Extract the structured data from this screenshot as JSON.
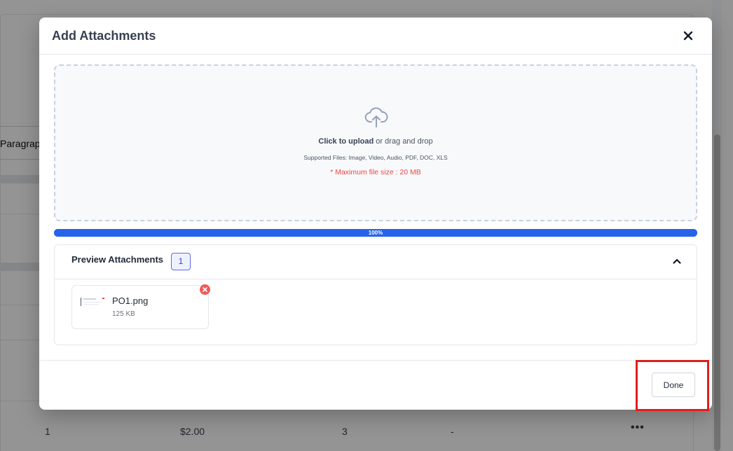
{
  "background": {
    "toolbar_fragment": "Paragraph",
    "row": {
      "col1": "1",
      "col2": "$2.00",
      "col3": "3",
      "col4": "-",
      "actions_icon": "more-horizontal-icon"
    }
  },
  "modal": {
    "title": "Add Attachments",
    "close_icon": "close-icon",
    "dropzone": {
      "icon": "cloud-upload-icon",
      "click_text": "Click to upload",
      "drag_text": "or drag and drop",
      "supported": "Supported Files: Image, Video, Audio, PDF, DOC, XLS",
      "max_size": "* Maximum file size : 20 MB"
    },
    "progress": {
      "percent": 100,
      "label": "100%"
    },
    "preview": {
      "title": "Preview Attachments",
      "count": "1",
      "collapse_icon": "chevron-up-icon",
      "files": [
        {
          "name": "PO1.png",
          "size": "125 KB",
          "remove_icon": "close-circle-icon"
        }
      ]
    },
    "footer": {
      "done_label": "Done"
    }
  },
  "colors": {
    "accent": "#2563eb",
    "danger": "#ef4444",
    "highlight": "#e11d1d",
    "badge_border": "#6366f1"
  }
}
